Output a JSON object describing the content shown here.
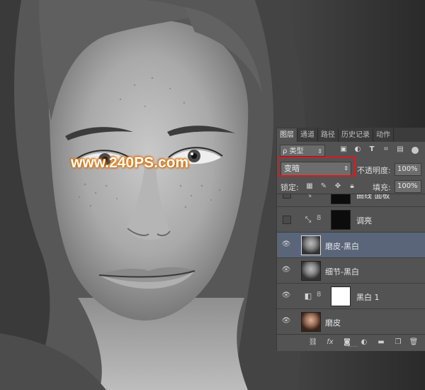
{
  "watermark": "www.240PS.com",
  "panel": {
    "tabs": [
      "图层",
      "通道",
      "路径",
      "历史记录",
      "动作"
    ],
    "filter": {
      "kind_label": "类型",
      "kind_prefix": "ρ"
    },
    "filter_icons": [
      "image-filter-icon",
      "adjustment-filter-icon",
      "type-filter-icon",
      "shape-filter-icon",
      "smart-object-filter-icon"
    ],
    "blend_mode": "变暗",
    "opacity_label": "不透明度:",
    "opacity_value": "100%",
    "lock_label": "锁定:",
    "fill_label": "填充:",
    "fill_value": "100%",
    "layers": [
      {
        "name": "曲线 面板",
        "type": "adjustment",
        "visible": false
      },
      {
        "name": "调亮",
        "type": "adjustment",
        "visible": false
      },
      {
        "name": "磨皮-黑白",
        "type": "image",
        "visible": true,
        "selected": true
      },
      {
        "name": "细节-黑白",
        "type": "image",
        "visible": true
      },
      {
        "name": "黑白 1",
        "type": "adjustment",
        "visible": true
      },
      {
        "name": "磨皮",
        "type": "image",
        "visible": true,
        "color": true
      }
    ],
    "bottom_icons": [
      "link-icon",
      "fx-icon",
      "mask-icon",
      "adjustment-icon",
      "folder-icon",
      "new-layer-icon",
      "trash-icon"
    ],
    "fx_label": "fx"
  },
  "colors": {
    "panel_bg": "#535353",
    "tab_bar": "#3c3c3c",
    "selected_layer": "#5a6579",
    "highlight_box": "#e0181e",
    "watermark_glow": "#e07a10"
  }
}
